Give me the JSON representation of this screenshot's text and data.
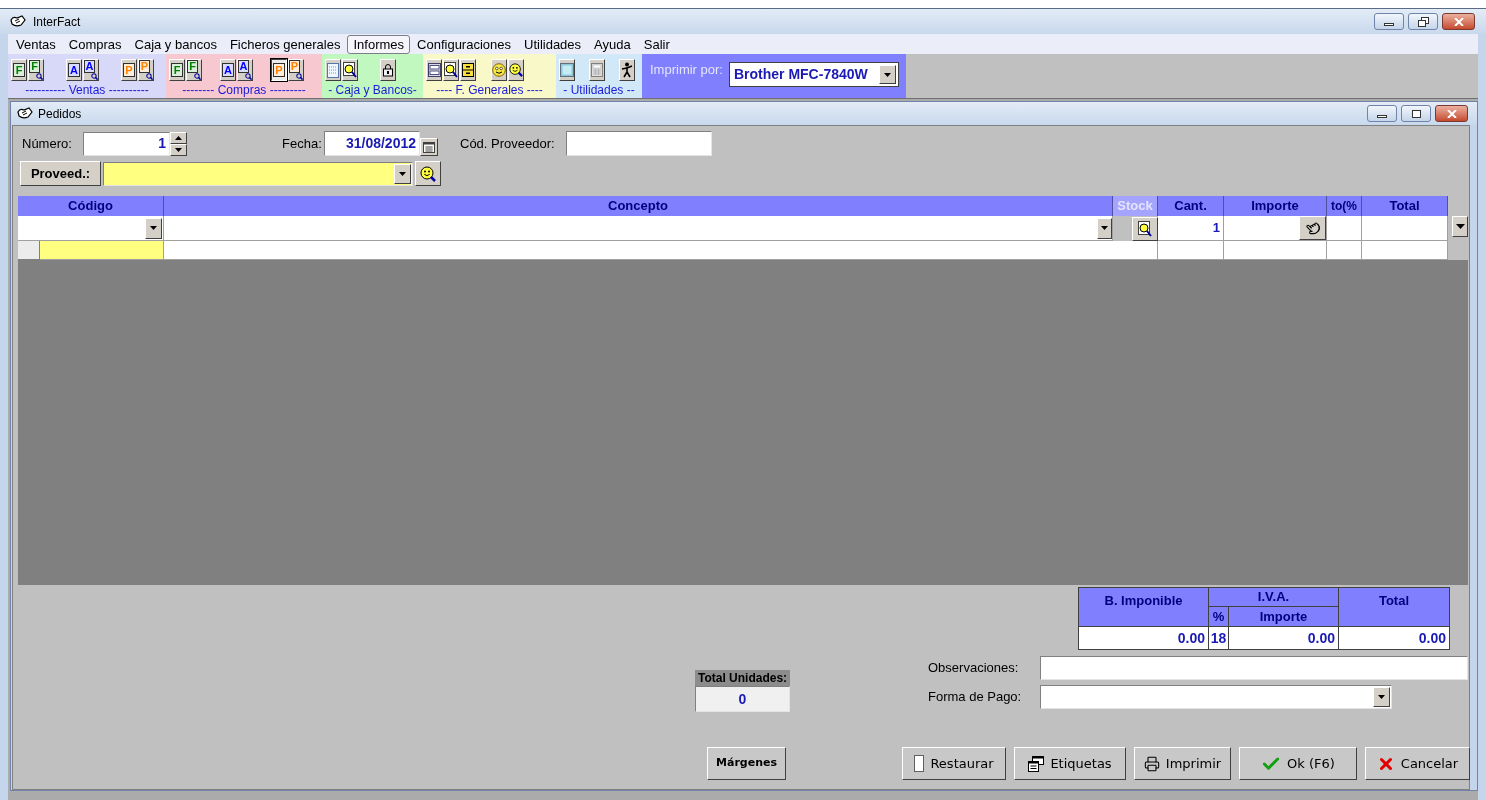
{
  "window": {
    "title": "InterFact"
  },
  "menu": [
    {
      "label": "Ventas",
      "selected": false
    },
    {
      "label": "Compras",
      "selected": false
    },
    {
      "label": "Caja y bancos",
      "selected": false
    },
    {
      "label": "Ficheros generales",
      "selected": false
    },
    {
      "label": "Informes",
      "selected": true
    },
    {
      "label": "Configuraciones",
      "selected": false
    },
    {
      "label": "Utilidades",
      "selected": false
    },
    {
      "label": "Ayuda",
      "selected": false
    },
    {
      "label": "Salir",
      "selected": false
    }
  ],
  "toolbar": {
    "groups": [
      {
        "label": "---------- Ventas ----------",
        "color": "#d8d8f8",
        "clusters": [
          [
            {
              "kind": "letter",
              "glyph": "F",
              "color": "#008000",
              "pressed": false
            },
            {
              "kind": "letter-search",
              "glyph": "F",
              "color": "#008000",
              "pressed": false
            }
          ],
          [
            {
              "kind": "letter",
              "glyph": "A",
              "color": "#0000ff",
              "pressed": false
            },
            {
              "kind": "letter-search",
              "glyph": "A",
              "color": "#0000ff",
              "pressed": false
            }
          ],
          [
            {
              "kind": "letter",
              "glyph": "P",
              "color": "#ff8000",
              "pressed": false
            },
            {
              "kind": "letter-search",
              "glyph": "P",
              "color": "#ff8000",
              "pressed": false
            }
          ]
        ]
      },
      {
        "label": "-------- Compras ---------",
        "color": "#f8c8d0",
        "clusters": [
          [
            {
              "kind": "letter",
              "glyph": "F",
              "color": "#008000",
              "pressed": false
            },
            {
              "kind": "letter-search",
              "glyph": "F",
              "color": "#008000",
              "pressed": false
            }
          ],
          [
            {
              "kind": "letter",
              "glyph": "A",
              "color": "#0000ff",
              "pressed": false
            },
            {
              "kind": "letter-search",
              "glyph": "A",
              "color": "#0000ff",
              "pressed": false
            }
          ],
          [
            {
              "kind": "letter",
              "glyph": "P",
              "color": "#ff8000",
              "pressed": true
            },
            {
              "kind": "letter-search",
              "glyph": "P",
              "color": "#ff8000",
              "pressed": false
            }
          ]
        ]
      },
      {
        "label": "- Caja y Bancos-",
        "color": "#c0f8c0",
        "clusters": [
          [
            {
              "kind": "page",
              "pressed": false
            },
            {
              "kind": "search",
              "pressed": false
            }
          ],
          [
            {
              "kind": "lock",
              "pressed": false
            }
          ]
        ]
      },
      {
        "label": "---- F. Generales ----",
        "color": "#f8f8c8",
        "clusters": [
          [
            {
              "kind": "list",
              "pressed": false
            },
            {
              "kind": "search",
              "pressed": false
            },
            {
              "kind": "cabinet",
              "pressed": false
            }
          ],
          [
            {
              "kind": "face",
              "pressed": false
            },
            {
              "kind": "face-search",
              "pressed": false
            }
          ]
        ]
      },
      {
        "label": "- Utilidades --",
        "color": "#d0e8f8",
        "clusters": [
          [
            {
              "kind": "tile",
              "pressed": false
            }
          ],
          [
            {
              "kind": "calculator",
              "pressed": false
            }
          ],
          [
            {
              "kind": "figure",
              "pressed": false
            }
          ]
        ]
      }
    ],
    "printer": {
      "label": "Imprimir por:",
      "value": "Brother MFC-7840W"
    }
  },
  "order_window": {
    "title": "Pedidos"
  },
  "header": {
    "numero": {
      "label": "Número:",
      "value": "1"
    },
    "fecha": {
      "label": "Fecha:",
      "value": "31/08/2012"
    },
    "cod_proveedor": {
      "label": "Cód. Proveedor:"
    },
    "proveedor": {
      "button": "Proveed.:"
    }
  },
  "lines": {
    "columns": [
      {
        "label": "Código",
        "disabled": false
      },
      {
        "label": "Concepto",
        "disabled": false
      },
      {
        "label": "Stock",
        "disabled": true
      },
      {
        "label": "Cant.",
        "disabled": false
      },
      {
        "label": "Importe",
        "disabled": false
      },
      {
        "label": "to(%",
        "disabled": false
      },
      {
        "label": "Total",
        "disabled": false
      }
    ],
    "rows": [
      {
        "kind": "editing",
        "cantidad": "1"
      },
      {
        "kind": "new"
      }
    ]
  },
  "totals": {
    "base_label": "B. Imponible",
    "iva_label": "I.V.A.",
    "pct_label": "%",
    "iva_importe_label": "Importe",
    "total_label": "Total",
    "base": "0.00",
    "pct": "18",
    "iva_importe": "0.00",
    "total": "0.00"
  },
  "total_unidades": {
    "label": "Total Unidades:",
    "value": "0"
  },
  "observaciones": {
    "label": "Observaciones:"
  },
  "forma_pago": {
    "label": "Forma de Pago:"
  },
  "buttons": [
    {
      "kind": "plain",
      "label": "Márgenes"
    },
    {
      "kind": "restore",
      "label": "Restaurar"
    },
    {
      "kind": "labels",
      "label": "Etiquetas"
    },
    {
      "kind": "print",
      "label": "Imprimir"
    },
    {
      "kind": "ok",
      "label": "Ok (F6)"
    },
    {
      "kind": "cancel",
      "label": "Cancelar"
    }
  ]
}
